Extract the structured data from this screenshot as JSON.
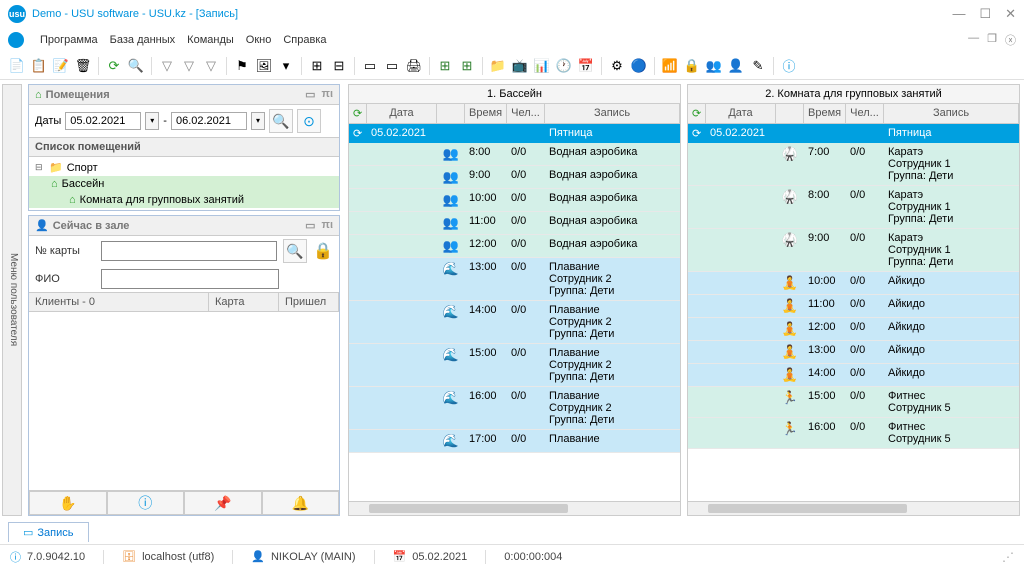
{
  "title": "Demo - USU software - USU.kz - [Запись]",
  "menu": {
    "program": "Программа",
    "database": "База данных",
    "commands": "Команды",
    "window": "Окно",
    "help": "Справка"
  },
  "user_menu_tab": "Меню пользователя",
  "rooms_panel": {
    "title": "Помещения",
    "dates_label": "Даты",
    "date_from": "05.02.2021",
    "date_to": "06.02.2021",
    "list_header": "Список помещений",
    "tree": {
      "root": "Спорт",
      "pool": "Бассейн",
      "group": "Комната для групповых занятий"
    }
  },
  "hall_panel": {
    "title": "Сейчас в зале",
    "card_label": "№ карты",
    "fio_label": "ФИО",
    "clients_header": "Клиенты - 0",
    "card_col": "Карта",
    "came_col": "Пришел"
  },
  "sched1": {
    "title": "1. Бассейн",
    "cols": {
      "date": "Дата",
      "time": "Время",
      "ppl": "Чел...",
      "rec": "Запись"
    },
    "day": {
      "date": "05.02.2021",
      "name": "Пятница"
    },
    "rows": [
      {
        "t": "8:00",
        "p": "0/0",
        "r": "Водная аэробика",
        "c": "a",
        "i": "👥"
      },
      {
        "t": "9:00",
        "p": "0/0",
        "r": "Водная аэробика",
        "c": "a",
        "i": "👥"
      },
      {
        "t": "10:00",
        "p": "0/0",
        "r": "Водная аэробика",
        "c": "a",
        "i": "👥"
      },
      {
        "t": "11:00",
        "p": "0/0",
        "r": "Водная аэробика",
        "c": "a",
        "i": "👥"
      },
      {
        "t": "12:00",
        "p": "0/0",
        "r": "Водная аэробика",
        "c": "a",
        "i": "👥"
      },
      {
        "t": "13:00",
        "p": "0/0",
        "r": "Плавание\nСотрудник 2\nГруппа: Дети",
        "c": "b",
        "i": "🌊"
      },
      {
        "t": "14:00",
        "p": "0/0",
        "r": "Плавание\nСотрудник 2\nГруппа: Дети",
        "c": "b",
        "i": "🌊"
      },
      {
        "t": "15:00",
        "p": "0/0",
        "r": "Плавание\nСотрудник 2\nГруппа: Дети",
        "c": "b",
        "i": "🌊"
      },
      {
        "t": "16:00",
        "p": "0/0",
        "r": "Плавание\nСотрудник 2\nГруппа: Дети",
        "c": "b",
        "i": "🌊"
      },
      {
        "t": "17:00",
        "p": "0/0",
        "r": "Плавание",
        "c": "b",
        "i": "🌊"
      }
    ]
  },
  "sched2": {
    "title": "2. Комната для групповых занятий",
    "cols": {
      "date": "Дата",
      "time": "Время",
      "ppl": "Чел...",
      "rec": "Запись"
    },
    "day": {
      "date": "05.02.2021",
      "name": "Пятница"
    },
    "rows": [
      {
        "t": "7:00",
        "p": "0/0",
        "r": "Каратэ\nСотрудник 1\nГруппа: Дети",
        "c": "a",
        "i": "🥋"
      },
      {
        "t": "8:00",
        "p": "0/0",
        "r": "Каратэ\nСотрудник 1\nГруппа: Дети",
        "c": "a",
        "i": "🥋"
      },
      {
        "t": "9:00",
        "p": "0/0",
        "r": "Каратэ\nСотрудник 1\nГруппа: Дети",
        "c": "a",
        "i": "🥋"
      },
      {
        "t": "10:00",
        "p": "0/0",
        "r": "Айкидо",
        "c": "b",
        "i": "🧘"
      },
      {
        "t": "11:00",
        "p": "0/0",
        "r": "Айкидо",
        "c": "b",
        "i": "🧘"
      },
      {
        "t": "12:00",
        "p": "0/0",
        "r": "Айкидо",
        "c": "b",
        "i": "🧘"
      },
      {
        "t": "13:00",
        "p": "0/0",
        "r": "Айкидо",
        "c": "b",
        "i": "🧘"
      },
      {
        "t": "14:00",
        "p": "0/0",
        "r": "Айкидо",
        "c": "b",
        "i": "🧘"
      },
      {
        "t": "15:00",
        "p": "0/0",
        "r": "Фитнес\nСотрудник 5",
        "c": "a",
        "i": "🏃"
      },
      {
        "t": "16:00",
        "p": "0/0",
        "r": "Фитнес\nСотрудник 5",
        "c": "a",
        "i": "🏃"
      }
    ]
  },
  "tab": "Запись",
  "status": {
    "version": "7.0.9042.10",
    "host": "localhost (utf8)",
    "user": "NIKOLAY (MAIN)",
    "date": "05.02.2021",
    "time": "0:00:00:004"
  }
}
